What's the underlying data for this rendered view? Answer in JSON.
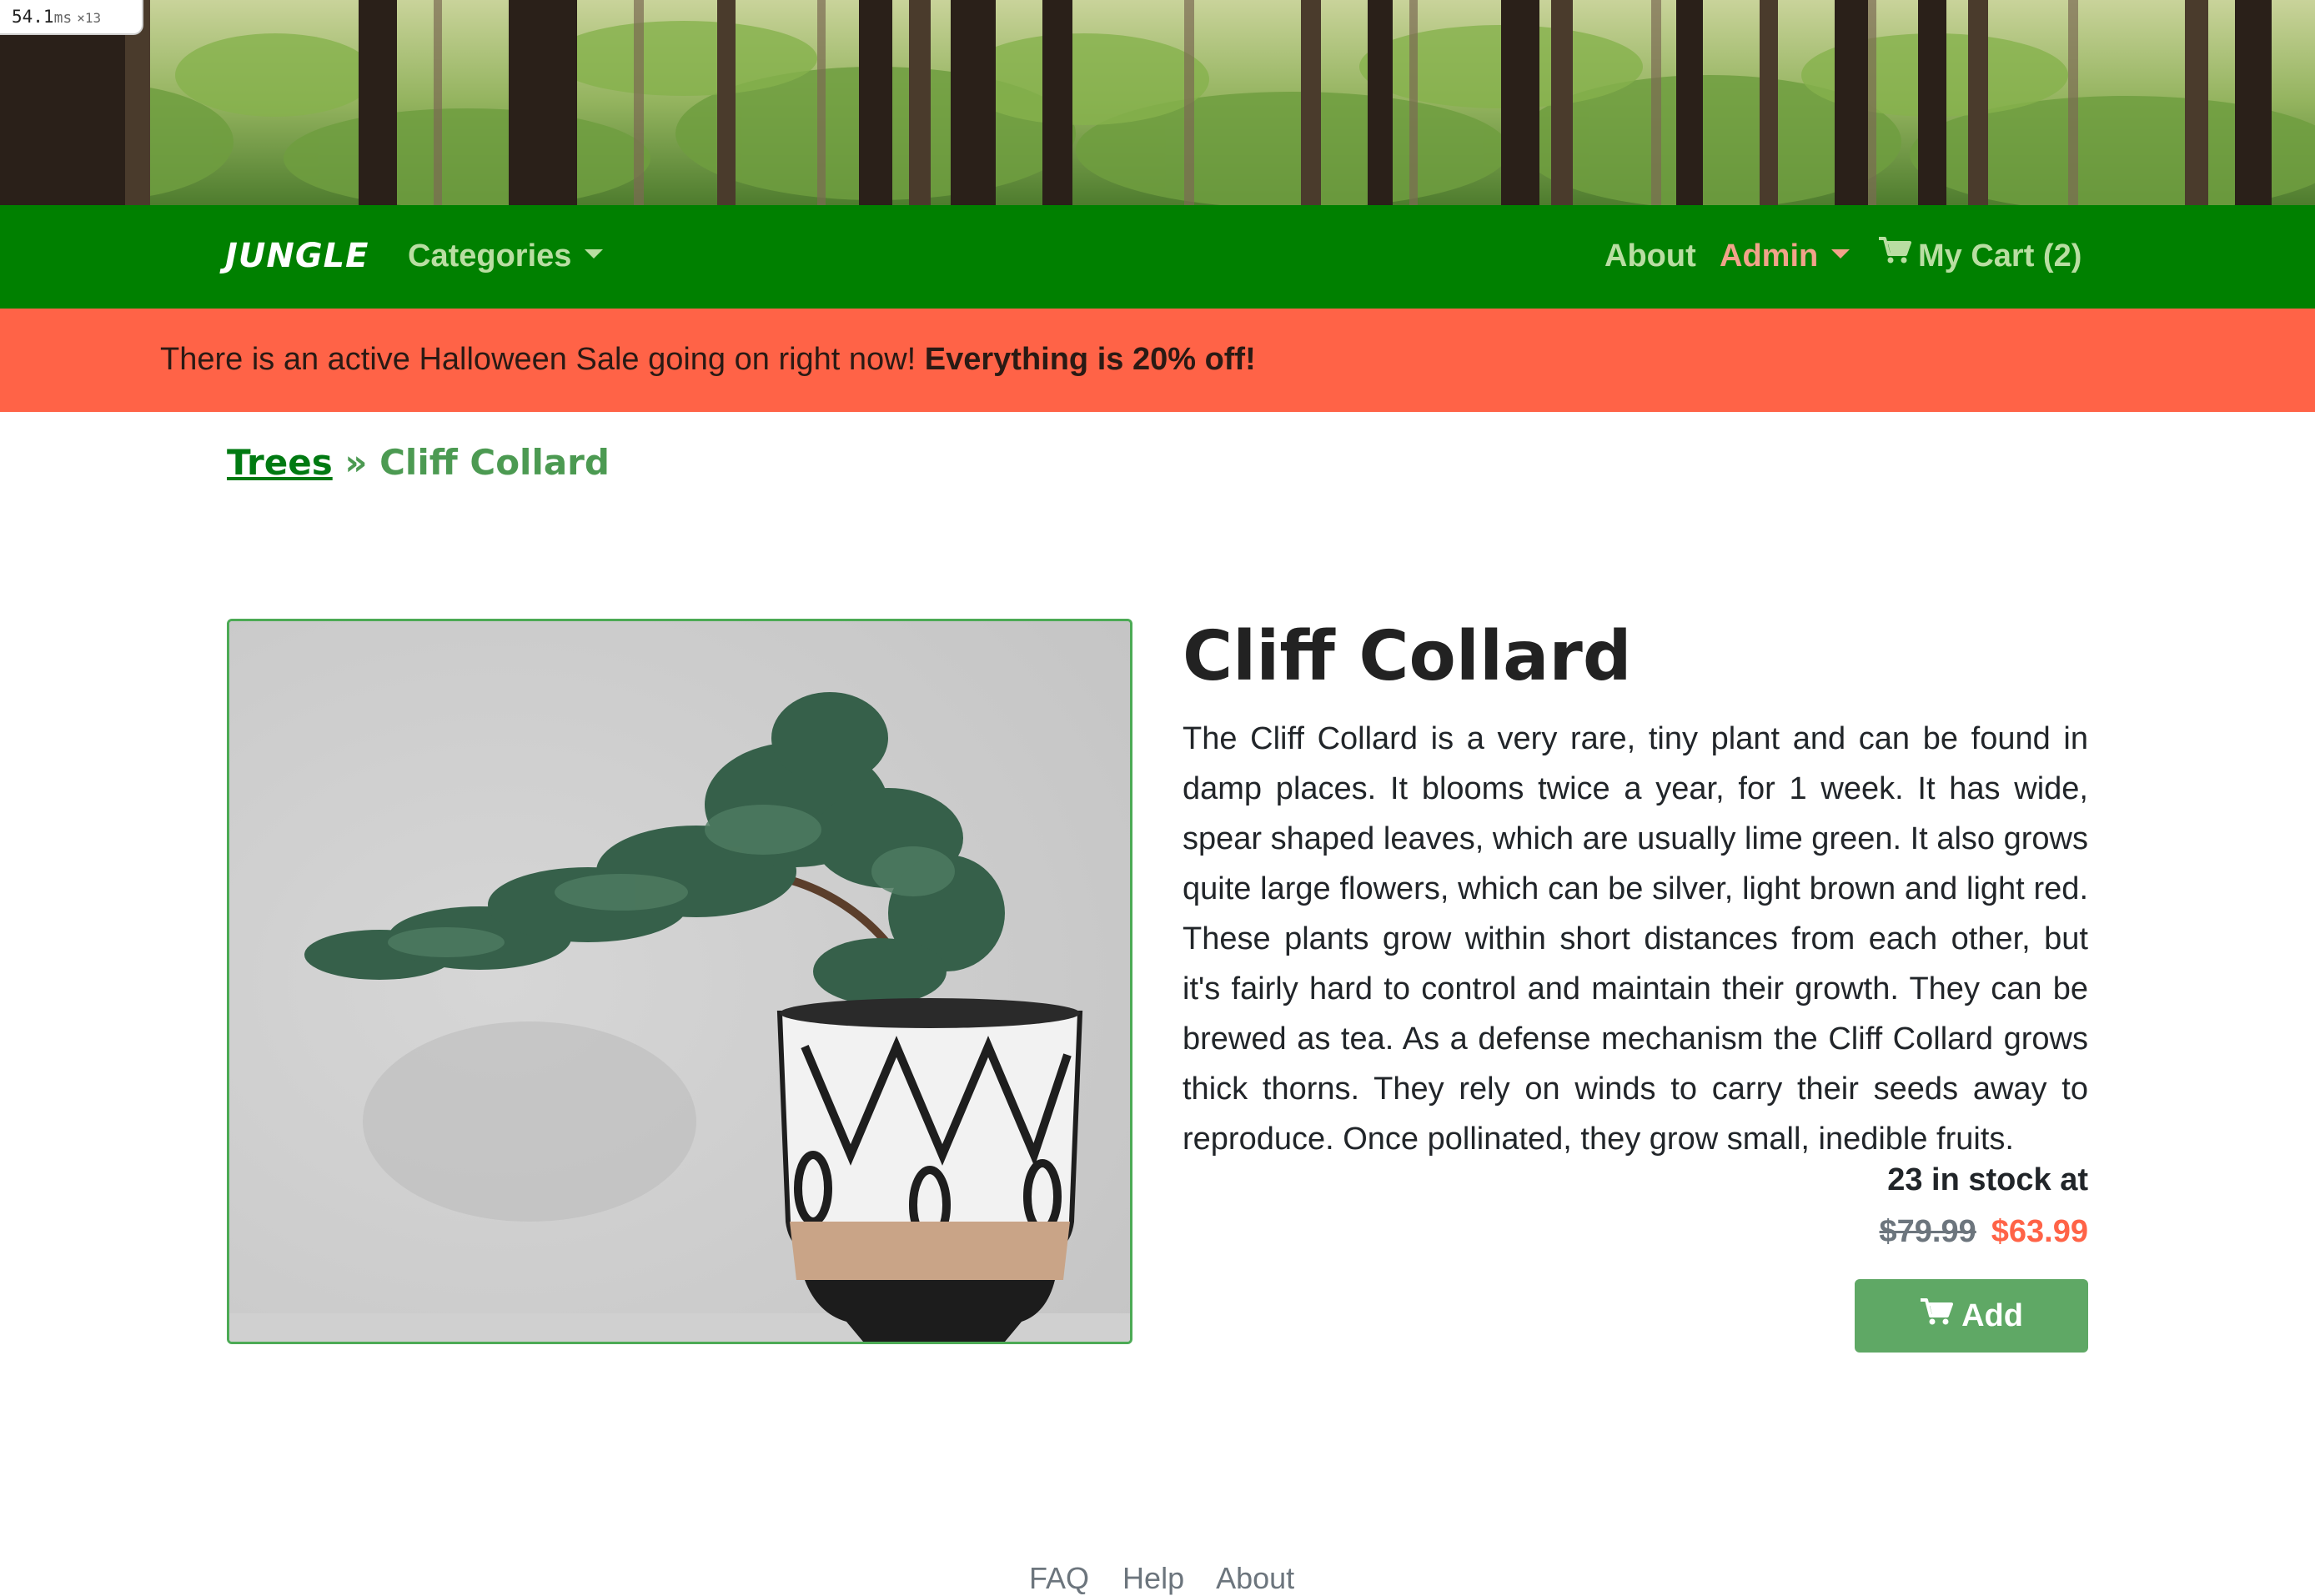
{
  "perf_badge": {
    "value": "54.1",
    "unit": "ms",
    "multiplier": "×13"
  },
  "navbar": {
    "brand": "JUNGLE",
    "categories_label": "Categories",
    "about_label": "About",
    "admin_label": "Admin",
    "cart_label": "My Cart (2)",
    "colors": {
      "background": "#008000",
      "link": "#b9dea2",
      "admin": "#f2a38a"
    }
  },
  "sale_banner": {
    "text": "There is an active Halloween Sale going on right now!",
    "highlight": "Everything is 20% off!",
    "color": "#ff6347"
  },
  "breadcrumb": {
    "parent": "Trees",
    "separator": "»",
    "current": "Cliff Collard"
  },
  "product": {
    "image_icon": "bonsai-in-patterned-pot",
    "title": "Cliff Collard",
    "description": "The Cliff Collard is a very rare, tiny plant and can be found in damp places. It blooms twice a year, for 1 week. It has wide, spear shaped leaves, which are usually lime green. It also grows quite large flowers, which can be silver, light brown and light red. These plants grow within short distances from each other, but it's fairly hard to control and maintain their growth. They can be brewed as tea. As a defense mechanism the Cliff Collard grows thick thorns. They rely on winds to carry their seeds away to reproduce. Once pollinated, they grow small, inedible fruits.",
    "stock_text": "23 in stock at",
    "old_price": "$79.99",
    "new_price": "$63.99",
    "add_label": "Add",
    "button_color": "#5fa865"
  },
  "footer": {
    "links": [
      "FAQ",
      "Help",
      "About"
    ]
  }
}
